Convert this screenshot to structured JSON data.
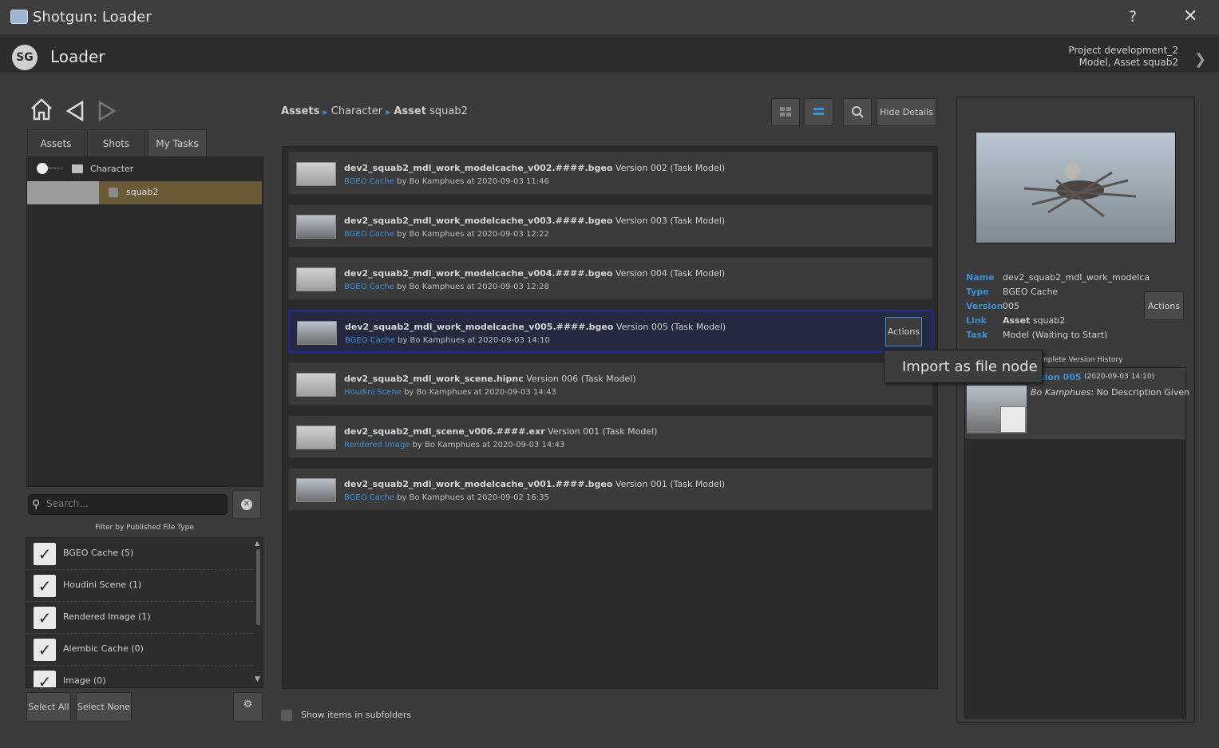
{
  "window": {
    "title": "Shotgun: Loader",
    "help": "?",
    "close": "✕"
  },
  "header": {
    "app_name": "Loader",
    "logo": "SG",
    "context_line1": "Project development_2",
    "context_line2": "Model, Asset squab2"
  },
  "nav": {
    "home": "⌂",
    "back": "◁",
    "forward": "▷"
  },
  "tabs": [
    "Assets",
    "Shots",
    "My Tasks"
  ],
  "tree": {
    "folder": "Character",
    "item": "squab2"
  },
  "search": {
    "placeholder": "Search..."
  },
  "filter": {
    "title": "Filter by Published File Type",
    "items": [
      "BGEO Cache (5)",
      "Houdini Scene (1)",
      "Rendered Image (1)",
      "Alembic Cache (0)",
      "Image (0)"
    ],
    "select_all": "Select All",
    "select_none": "Select None"
  },
  "breadcrumb": {
    "root": "Assets",
    "mid": "Character",
    "leaf_bold": "Asset",
    "leaf": "squab2"
  },
  "toolbar": {
    "hide_details": "Hide Details"
  },
  "publishes": [
    {
      "name": "dev2_squab2_mdl_work_modelcache_v002.####.bgeo",
      "version": "Version 002 (Task Model)",
      "type": "BGEO Cache",
      "meta": "by Bo Kamphues at 2020-09-03 11:46"
    },
    {
      "name": "dev2_squab2_mdl_work_modelcache_v003.####.bgeo",
      "version": "Version 003 (Task Model)",
      "type": "BGEO Cache",
      "meta": "by Bo Kamphues at 2020-09-03 12:22"
    },
    {
      "name": "dev2_squab2_mdl_work_modelcache_v004.####.bgeo",
      "version": "Version 004 (Task Model)",
      "type": "BGEO Cache",
      "meta": "by Bo Kamphues at 2020-09-03 12:28"
    },
    {
      "name": "dev2_squab2_mdl_work_modelcache_v005.####.bgeo",
      "version": "Version 005 (Task Model)",
      "type": "BGEO Cache",
      "meta": "by Bo Kamphues at 2020-09-03 14:10"
    },
    {
      "name": "dev2_squab2_mdl_work_scene.hipnc",
      "version": "Version 006 (Task Model)",
      "type": "Houdini Scene",
      "meta": "by Bo Kamphues at 2020-09-03 14:43"
    },
    {
      "name": "dev2_squab2_mdl_scene_v006.####.exr",
      "version": "Version 001 (Task Model)",
      "type": "Rendered Image",
      "meta": "by Bo Kamphues at 2020-09-03 14:43"
    },
    {
      "name": "dev2_squab2_mdl_work_modelcache_v001.####.bgeo",
      "version": "Version 001 (Task Model)",
      "type": "BGEO Cache",
      "meta": "by Bo Kamphues at 2020-09-02 16:35"
    }
  ],
  "actions_label": "Actions",
  "popup": {
    "item": "Import as file node"
  },
  "show_subfolders": "Show items in subfolders",
  "details": {
    "name_key": "Name",
    "name_val": "dev2_squab2_mdl_work_modelca",
    "type_key": "Type",
    "type_val": "BGEO Cache",
    "version_key": "Version",
    "version_val": "005",
    "link_key": "Link",
    "link_val_bold": "Asset",
    "link_val": "squab2",
    "task_key": "Task",
    "task_val": "Model (Waiting to Start)",
    "actions": "Actions",
    "history_title": "mplete Version History",
    "history_version": "sion 005",
    "history_date": "(2020-09-03 14:10)",
    "history_author": "Bo Kamphues",
    "history_desc": ": No Description Given"
  }
}
